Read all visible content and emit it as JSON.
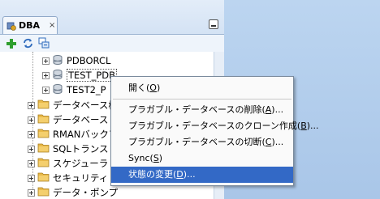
{
  "panel": {
    "tab_title": "DBA",
    "tab_close": "×"
  },
  "tree": {
    "children": [
      {
        "label": "PDBORCL"
      },
      {
        "label": "TEST_PDB"
      },
      {
        "label": "TEST2_P"
      }
    ],
    "folders": [
      {
        "label": "データベース構"
      },
      {
        "label": "データベース・"
      },
      {
        "label": "RMANバックア"
      },
      {
        "label": "SQLトランスレ"
      },
      {
        "label": "スケジューラ"
      },
      {
        "label": "セキュリティ"
      },
      {
        "label": "データ・ポンプ"
      }
    ]
  },
  "menu": {
    "items": [
      {
        "pre": "開く(",
        "key": "O",
        "post": ")"
      },
      {
        "pre": "プラガブル・データベースの削除(",
        "key": "A",
        "post": ")..."
      },
      {
        "pre": "プラガブル・データベースのクローン作成(",
        "key": "B",
        "post": ")..."
      },
      {
        "pre": "プラガブル・データベースの切断(",
        "key": "C",
        "post": ")..."
      },
      {
        "pre": "Sync(",
        "key": "S",
        "post": ")"
      },
      {
        "pre": "状態の変更(",
        "key": "D",
        "post": ")..."
      }
    ]
  },
  "colors": {
    "selection": "#3369c6",
    "folder": "#e9b949",
    "add_icon": "#2e9e2e"
  }
}
